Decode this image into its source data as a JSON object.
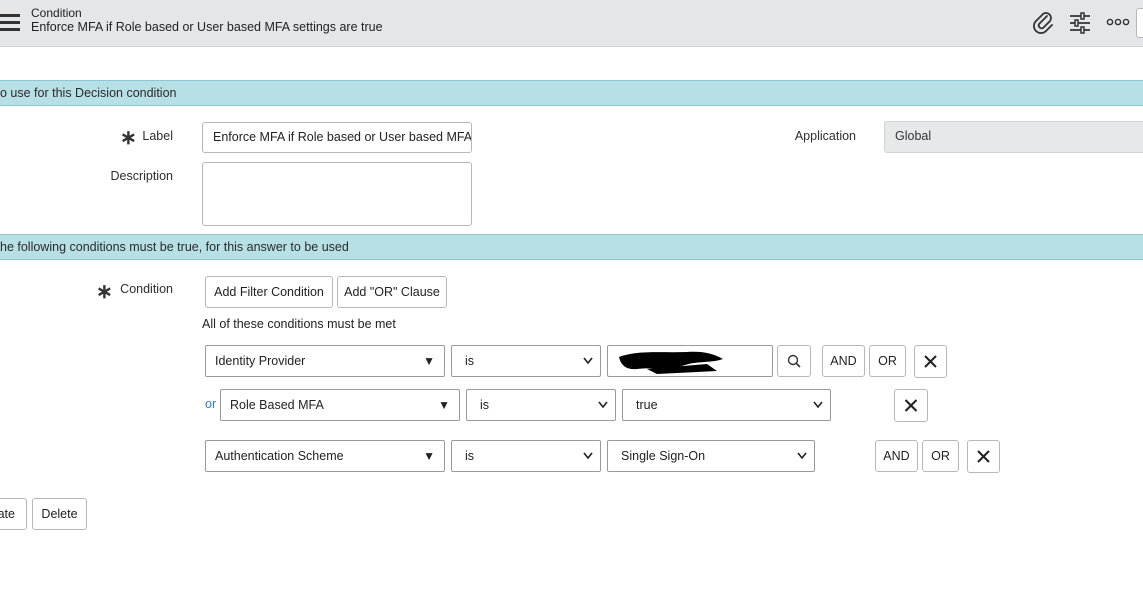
{
  "header": {
    "title": "Condition",
    "subtitle": "Enforce MFA if Role based or User based MFA settings are true",
    "icons": [
      "menu-icon",
      "paperclip-icon",
      "settings-sliders-icon",
      "more-options-icon"
    ]
  },
  "section1": {
    "text": "o use for this Decision condition"
  },
  "form": {
    "label_label": "Label",
    "label_value": "Enforce MFA if Role based or User based MFA se",
    "application_label": "Application",
    "application_value": "Global",
    "description_label": "Description",
    "description_value": ""
  },
  "section2": {
    "text": "he following conditions must be true, for this answer to be used"
  },
  "condition": {
    "label": "Condition",
    "add_filter_label": "Add Filter Condition",
    "add_or_label": "Add \"OR\" Clause",
    "all_met_text": "All of these conditions must be met",
    "rows": [
      {
        "prefix": "",
        "field": "Identity Provider",
        "operator": "is",
        "value": "",
        "and": "AND",
        "or": "OR"
      },
      {
        "prefix": "or",
        "field": "Role Based MFA",
        "operator": "is",
        "value": "true"
      },
      {
        "prefix": "",
        "field": "Authentication Scheme",
        "operator": "is",
        "value": "Single Sign-On",
        "and": "AND",
        "or": "OR"
      }
    ]
  },
  "footer": {
    "update_label": "ate",
    "delete_label": "Delete"
  },
  "colors": {
    "header_bg": "#e4e6e7",
    "section_bg": "#b7dfe6",
    "link": "#2e7db5"
  }
}
